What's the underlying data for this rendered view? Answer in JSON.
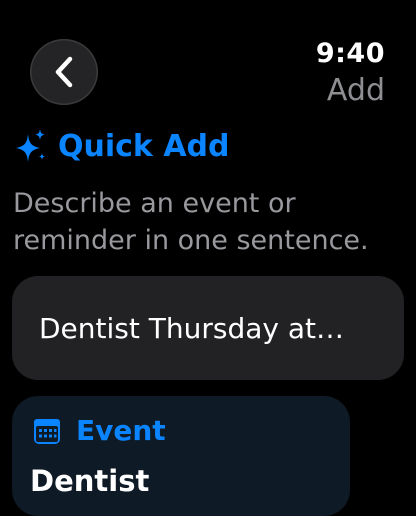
{
  "status": {
    "time": "9:40",
    "screen_title": "Add"
  },
  "navigation": {
    "back_icon": "chevron-left-icon"
  },
  "quick_add": {
    "icon": "sparkles-icon",
    "title": "Quick Add",
    "description": "Describe an event or reminder in one sentence.",
    "input_value": "Dentist Thursday at…"
  },
  "result": {
    "icon": "calendar-icon",
    "type_label": "Event",
    "title": "Dentist"
  },
  "colors": {
    "accent": "#0a84ff",
    "background": "#000000",
    "secondary_text": "#98989d",
    "input_background": "#222224",
    "card_background": "#0e1a26"
  }
}
